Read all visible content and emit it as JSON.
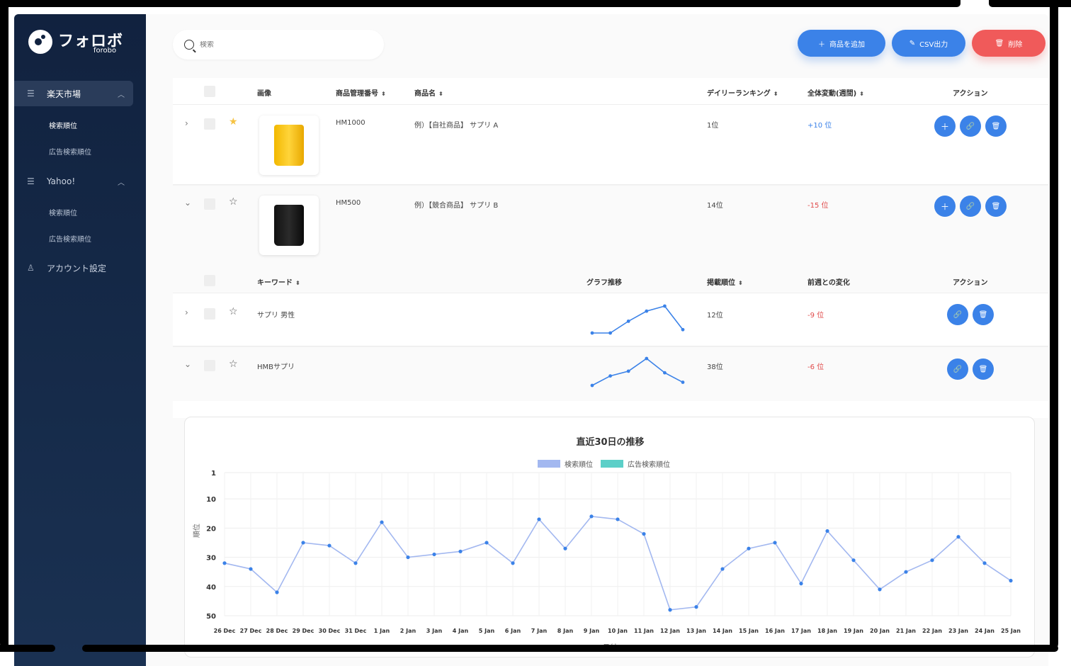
{
  "app": {
    "logo_text": "フォロボ",
    "logo_sub": "forobo"
  },
  "sidebar": {
    "groups": [
      {
        "label": "楽天市場",
        "icon": "list-icon",
        "items": [
          "検索順位",
          "広告検索順位"
        ]
      },
      {
        "label": "Yahoo!",
        "icon": "list-icon",
        "items": [
          "検索順位",
          "広告検索順位"
        ]
      }
    ],
    "account": "アカウント設定"
  },
  "search": {
    "placeholder": "検索"
  },
  "toolbar": {
    "add_label": "商品を追加",
    "csv_label": "CSV出力",
    "delete_label": "削除"
  },
  "product_table": {
    "headers": [
      "画像",
      "商品管理番号",
      "商品名",
      "デイリーランキング",
      "全体変動(週間)",
      "アクション"
    ],
    "rows": [
      {
        "code": "HM1000",
        "name": "例）【自社商品】 サプリ A",
        "rank": "1位",
        "change": "+10 位",
        "starred": true,
        "image": "yellow-pouch"
      },
      {
        "code": "HM500",
        "name": "例）【競合商品】 サプリ B",
        "rank": "14位",
        "change": "-15 位",
        "starred": false,
        "image": "black-pouch"
      }
    ]
  },
  "keyword_table": {
    "headers": [
      "キーワード",
      "グラフ推移",
      "掲載順位",
      "前週との変化",
      "アクション"
    ],
    "rows": [
      {
        "keyword": "サプリ 男性",
        "rank": "12位",
        "change": "-9 位",
        "spark": [
          24,
          24,
          17,
          11,
          8,
          22
        ]
      },
      {
        "keyword": "HMBサプリ",
        "rank": "38位",
        "change": "-6 位",
        "spark": [
          40,
          34,
          31,
          23,
          32,
          38
        ]
      }
    ]
  },
  "chart_data": {
    "type": "line",
    "title": "直近30日の推移",
    "xlabel": "日付",
    "ylabel": "順位",
    "y_reversed": true,
    "ylim": [
      1,
      50
    ],
    "yticks": [
      1,
      10,
      20,
      30,
      40,
      50
    ],
    "categories": [
      "26 Dec",
      "27 Dec",
      "28 Dec",
      "29 Dec",
      "30 Dec",
      "31 Dec",
      "1 Jan",
      "2 Jan",
      "3 Jan",
      "4 Jan",
      "5 Jan",
      "6 Jan",
      "7 Jan",
      "8 Jan",
      "9 Jan",
      "10 Jan",
      "11 Jan",
      "12 Jan",
      "13 Jan",
      "14 Jan",
      "15 Jan",
      "16 Jan",
      "17 Jan",
      "18 Jan",
      "19 Jan",
      "20 Jan",
      "21 Jan",
      "22 Jan",
      "23 Jan",
      "24 Jan",
      "25 Jan"
    ],
    "series": [
      {
        "name": "検索順位",
        "color": "#a3b8f0",
        "values": [
          32,
          34,
          42,
          25,
          26,
          32,
          18,
          30,
          29,
          28,
          25,
          32,
          17,
          27,
          16,
          17,
          22,
          48,
          47,
          34,
          27,
          25,
          39,
          21,
          31,
          41,
          35,
          31,
          23,
          32,
          38
        ]
      },
      {
        "name": "広告検索順位",
        "color": "#5ccfc8",
        "values": []
      }
    ],
    "legend_position": "top-center",
    "grid": true
  },
  "colors": {
    "accent": "#3b82e8",
    "danger": "#f05a5a",
    "sidebar": "#11223f",
    "positive": "#3b82e8",
    "negative": "#e04a4a"
  }
}
